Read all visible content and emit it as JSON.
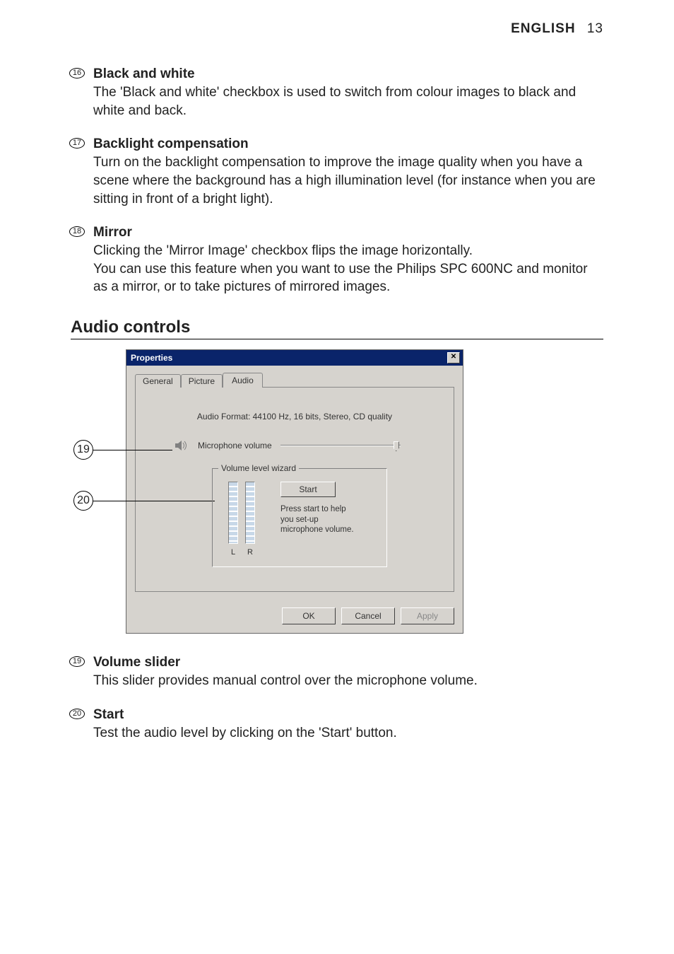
{
  "header": {
    "lang": "ENGLISH",
    "pageno": "13"
  },
  "sections": [
    {
      "marker": "16",
      "title": "Black and white",
      "body": "The 'Black and white' checkbox is used to switch from colour images to black and white and back."
    },
    {
      "marker": "17",
      "title": "Backlight compensation",
      "body": "Turn on the backlight compensation to improve the image quality when you have a scene where the background has a high illumination level (for instance when you are sitting in front of a bright light)."
    },
    {
      "marker": "18",
      "title": "Mirror",
      "body": "Clicking the 'Mirror Image' checkbox flips the image horizontally.\nYou can use this feature when you want to use the Philips SPC 600NC and monitor as a mirror, or to take pictures of mirrored images."
    }
  ],
  "audioHeading": "Audio controls",
  "dialog": {
    "title": "Properties",
    "tabs": {
      "general": "General",
      "picture": "Picture",
      "audio": "Audio"
    },
    "audioFormat": "Audio Format: 44100 Hz, 16 bits, Stereo, CD quality",
    "microphoneVolume": "Microphone volume",
    "wizard": {
      "legend": "Volume level wizard",
      "start": "Start",
      "hint": "Press start to help you set-up microphone volume.",
      "L": "L",
      "R": "R"
    },
    "buttons": {
      "ok": "OK",
      "cancel": "Cancel",
      "apply": "Apply"
    }
  },
  "callouts": {
    "c19": "19",
    "c20": "20"
  },
  "lower": [
    {
      "marker": "19",
      "title": "Volume slider",
      "body": "This slider provides manual control over the microphone volume."
    },
    {
      "marker": "20",
      "title": "Start",
      "body": "Test the audio level by clicking on the 'Start' button."
    }
  ]
}
